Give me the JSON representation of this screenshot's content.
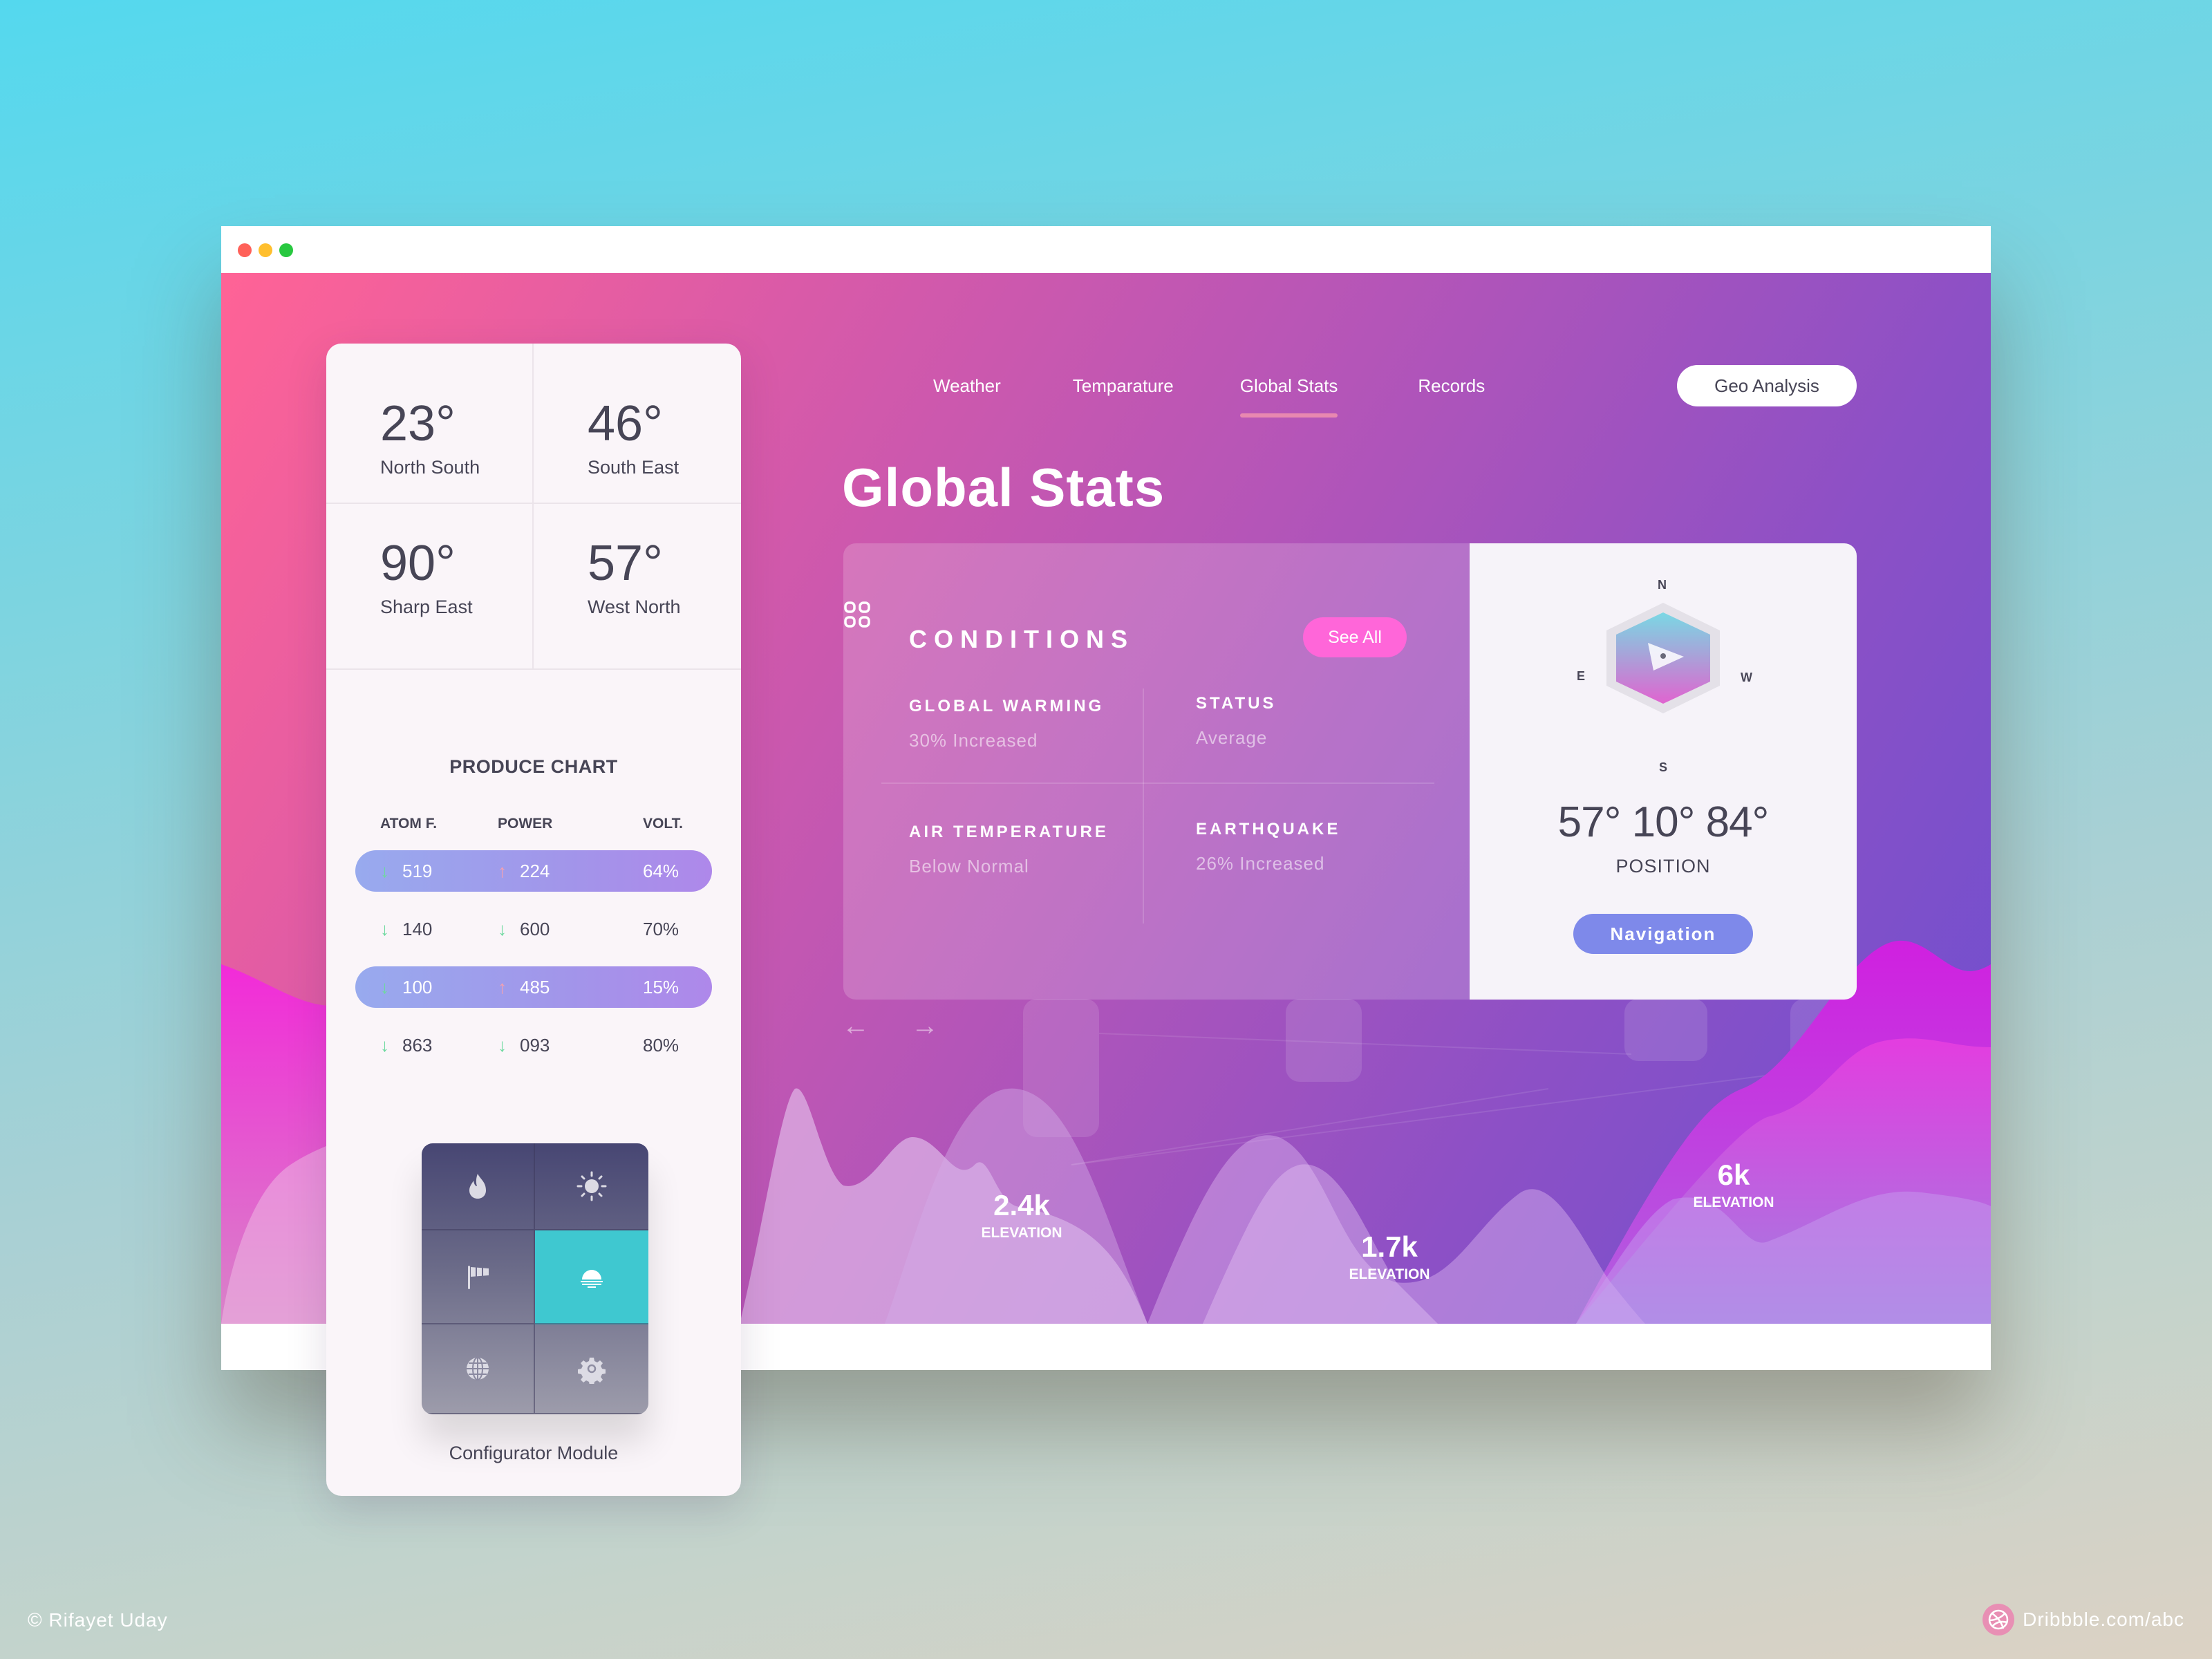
{
  "window": {
    "controls": [
      "close",
      "minimize",
      "maximize"
    ]
  },
  "stats": [
    {
      "value": "23°",
      "label": "North South"
    },
    {
      "value": "46°",
      "label": "South East"
    },
    {
      "value": "90°",
      "label": "Sharp East"
    },
    {
      "value": "57°",
      "label": "West North"
    }
  ],
  "produce_chart": {
    "title": "PRODUCE CHART",
    "headers": [
      "ATOM F.",
      "POWER",
      "VOLT."
    ],
    "rows": [
      {
        "atom": "519",
        "atom_dir": "down",
        "power": "224",
        "power_dir": "up",
        "volt": "64%",
        "highlight": true
      },
      {
        "atom": "140",
        "atom_dir": "down",
        "power": "600",
        "power_dir": "down",
        "volt": "70%",
        "highlight": false
      },
      {
        "atom": "100",
        "atom_dir": "down",
        "power": "485",
        "power_dir": "up",
        "volt": "15%",
        "highlight": true
      },
      {
        "atom": "863",
        "atom_dir": "down",
        "power": "093",
        "power_dir": "down",
        "volt": "80%",
        "highlight": false
      }
    ]
  },
  "configurator": {
    "label": "Configurator Module",
    "items": [
      {
        "icon": "flame-icon",
        "active": false
      },
      {
        "icon": "sun-icon",
        "active": false
      },
      {
        "icon": "windsock-icon",
        "active": false
      },
      {
        "icon": "sunset-icon",
        "active": true
      },
      {
        "icon": "globe-icon",
        "active": false
      },
      {
        "icon": "gear-icon",
        "active": false
      }
    ],
    "accent": "#3fc8d0"
  },
  "nav": {
    "menu_icon": "grid-icon",
    "items": [
      "Weather",
      "Temparature",
      "Global Stats",
      "Records"
    ],
    "active": "Global Stats",
    "action_button": "Geo Analysis"
  },
  "page": {
    "title": "Global Stats"
  },
  "conditions": {
    "title": "CONDITIONS",
    "see_all": "See All",
    "items": [
      {
        "label": "GLOBAL WARMING",
        "value": "30% Increased"
      },
      {
        "label": "STATUS",
        "value": "Average"
      },
      {
        "label": "AIR TEMPERATURE",
        "value": "Below Normal"
      },
      {
        "label": "EARTHQUAKE",
        "value": "26% Increased"
      }
    ]
  },
  "compass": {
    "north": "N",
    "south": "S",
    "east": "E",
    "west": "W",
    "position": "57° 10° 84°",
    "position_label": "POSITION",
    "button": "Navigation",
    "button_color": "#7e89ea"
  },
  "carousel": {
    "prev": "←",
    "next": "→"
  },
  "elevations": [
    {
      "value": "2.4k",
      "label": "ELEVATION"
    },
    {
      "value": "1.7k",
      "label": "ELEVATION"
    },
    {
      "value": "6k",
      "label": "ELEVATION"
    }
  ],
  "footer": {
    "credit": "© Rifayet Uday",
    "link": "Dribbble.com/abc"
  },
  "colors": {
    "see_all": "#ff66d9",
    "arrow_down": "#6ed9a0",
    "arrow_up": "#f5a0b0",
    "text_dark": "#474556"
  }
}
